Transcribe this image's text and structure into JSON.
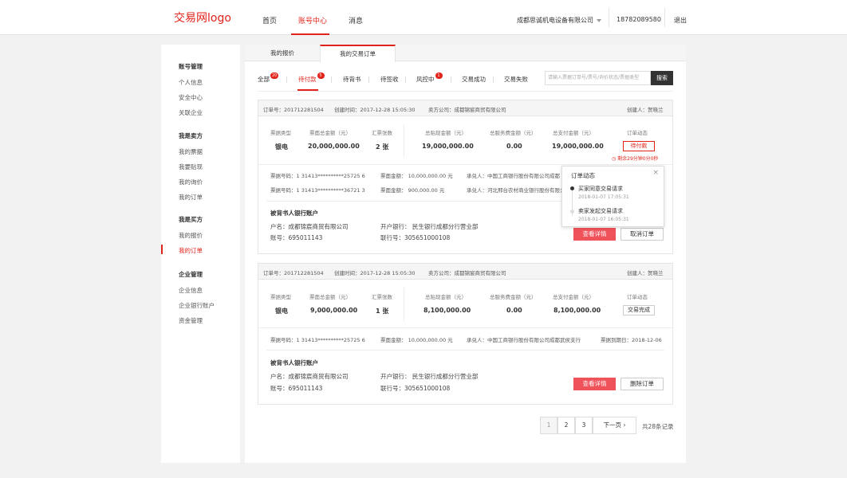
{
  "header": {
    "logo": "交易网logo",
    "nav": [
      "首页",
      "账号中心",
      "消息"
    ],
    "active_nav": "账号中心",
    "company": "成都思诚机电设备有限公司",
    "phone": "18782089580",
    "logout": "退出"
  },
  "sidebar": {
    "groups": [
      {
        "title": "账号管理",
        "items": [
          "个人信息",
          "安全中心",
          "关联企业"
        ]
      },
      {
        "title": "我是卖方",
        "items": [
          "我的票据",
          "我要贴现",
          "我的询价",
          "我的订单"
        ]
      },
      {
        "title": "我是买方",
        "items": [
          "我的报价",
          "我的订单"
        ]
      },
      {
        "title": "企业管理",
        "items": [
          "企业信息",
          "企业银行账户",
          "资金管理"
        ]
      }
    ]
  },
  "tabs": {
    "top": [
      "我的报价",
      "我的交易订单"
    ],
    "filters": [
      {
        "label": "全部",
        "badge": "20"
      },
      {
        "label": "待付款",
        "badge": "5"
      },
      {
        "label": "待背书",
        "badge": ""
      },
      {
        "label": "待签收",
        "badge": ""
      },
      {
        "label": "风控中",
        "badge": "1"
      },
      {
        "label": "交易成功",
        "badge": ""
      },
      {
        "label": "交易失败",
        "badge": ""
      }
    ]
  },
  "search": {
    "placeholder": "请输入票据订单号/票号/询价状态/票据类型",
    "button": "搜索"
  },
  "orders": [
    {
      "order_no": "订单号：201712281504",
      "created": "创建时间：2017-12-28  15:05:30",
      "seller": "卖方公司：成都锦宸商贸有限公司",
      "creator": "创建人：贺晓兰",
      "headers": [
        "票据类型",
        "票面总金额（元）",
        "汇票张数",
        "总贴现金额（元）",
        "总服务费金额（元）",
        "总支付金额（元）",
        "订单动态"
      ],
      "values": [
        "银电",
        "20,000,000.00",
        "2 张",
        "19,000,000.00",
        "0.00",
        "19,000,000.00"
      ],
      "status": "待付款",
      "countdown": "剩余29分钟0分0秒",
      "bills": [
        {
          "no": "票据号码：1 31413**********25725 6",
          "amount": "票面金额：  10,000,000.00  元",
          "acceptor": "承兑人：中国工商银行股份有限公司成都"
        },
        {
          "no": "票据号码：1 31413**********36721 3",
          "amount": "票面金额：  900,000.00  元",
          "acceptor": "承兑人：河北邢台农村商业银行股份有限公司"
        }
      ],
      "account_title": "被背书人银行账户",
      "account_name": "户名：成都锦宸商贸有限公司",
      "account_no": "账号：695011143",
      "bank": "开户银行：  民生银行成都分行营业部",
      "bank_no": "联行号：305651000108",
      "btn_detail": "查看详情",
      "btn_action": "取消订单"
    },
    {
      "order_no": "订单号：201712281504",
      "created": "创建时间：2017-12-28  15:05:30",
      "seller": "卖方公司：成都锦宸商贸有限公司",
      "creator": "创建人：贺晓兰",
      "headers": [
        "票据类型",
        "票面总金额（元）",
        "汇票张数",
        "总贴现金额（元）",
        "总服务费金额（元）",
        "总支付金额（元）",
        "订单动态"
      ],
      "values": [
        "银电",
        "9,000,000.00",
        "1 张",
        "8,100,000.00",
        "0.00",
        "8,100,000.00"
      ],
      "status": "交易完成",
      "bills": [
        {
          "no": "票据号码：1 31413**********25725 6",
          "amount": "票面金额：  10,000,000.00  元",
          "acceptor": "承兑人：中国工商银行股份有限公司成都武侯支行",
          "due": "票据到期日：2018-12-06"
        }
      ],
      "account_title": "被背书人银行账户",
      "account_name": "户名：成都锦宸商贸有限公司",
      "account_no": "账号：695011143",
      "bank": "开户银行：  民生银行成都分行营业部",
      "bank_no": "联行号：305651000108",
      "btn_detail": "查看详情",
      "btn_action": "删除订单"
    }
  ],
  "popup": {
    "title": "订单动态",
    "events": [
      {
        "text": "买家同意交易请求",
        "time": "2018-01-07  17:05:31"
      },
      {
        "text": "卖家发起交易请求",
        "time": "2018-01-07  16:05:31"
      }
    ]
  },
  "pagination": {
    "pages": [
      "1",
      "2",
      "3"
    ],
    "next": "下一页",
    "total": "共28条记录"
  },
  "colors": {
    "accent": "#e2231a",
    "button_red": "#f0525a"
  }
}
